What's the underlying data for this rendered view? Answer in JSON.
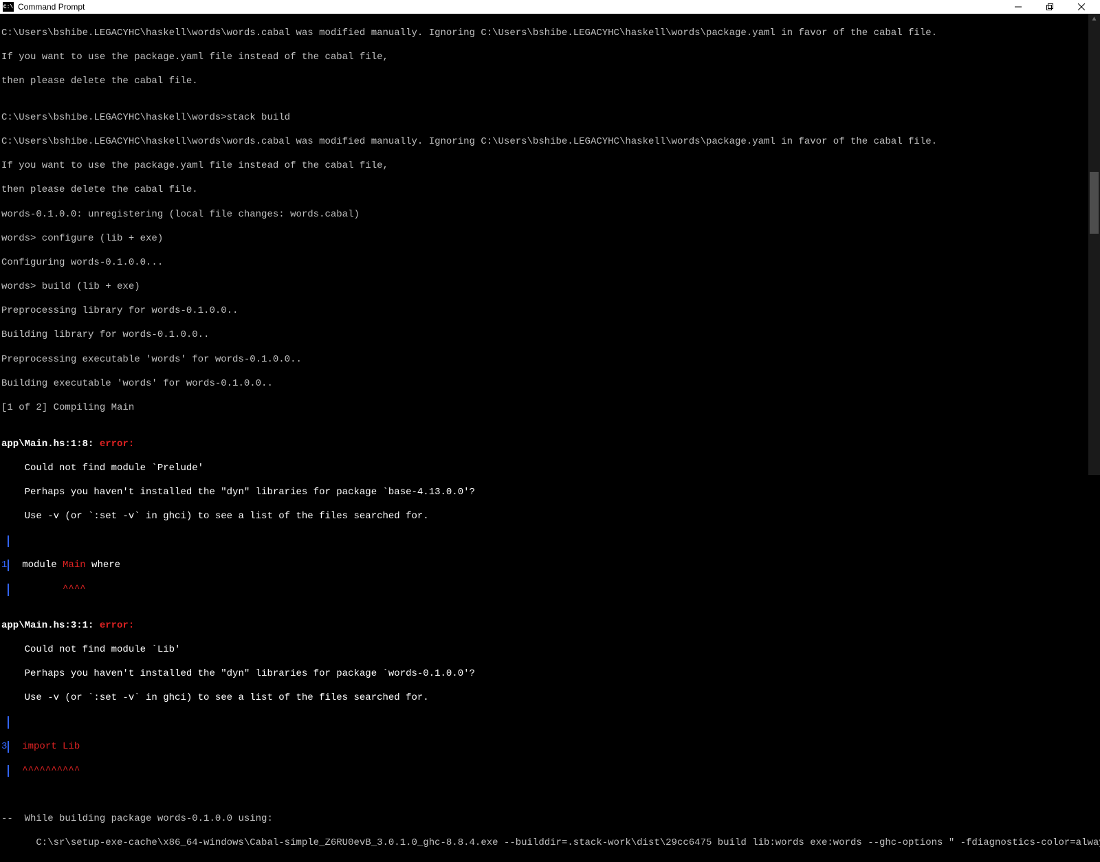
{
  "window": {
    "icon_text": "C:\\",
    "title": "Command Prompt"
  },
  "lines": {
    "l1": "C:\\Users\\bshibe.LEGACYHC\\haskell\\words\\words.cabal was modified manually. Ignoring C:\\Users\\bshibe.LEGACYHC\\haskell\\words\\package.yaml in favor of the cabal file.",
    "l2": "If you want to use the package.yaml file instead of the cabal file,",
    "l3": "then please delete the cabal file.",
    "l4": "",
    "l5": "C:\\Users\\bshibe.LEGACYHC\\haskell\\words>stack build",
    "l6": "C:\\Users\\bshibe.LEGACYHC\\haskell\\words\\words.cabal was modified manually. Ignoring C:\\Users\\bshibe.LEGACYHC\\haskell\\words\\package.yaml in favor of the cabal file.",
    "l7": "If you want to use the package.yaml file instead of the cabal file,",
    "l8": "then please delete the cabal file.",
    "l9": "words-0.1.0.0: unregistering (local file changes: words.cabal)",
    "l10": "words> configure (lib + exe)",
    "l11": "Configuring words-0.1.0.0...",
    "l12": "words> build (lib + exe)",
    "l13": "Preprocessing library for words-0.1.0.0..",
    "l14": "Building library for words-0.1.0.0..",
    "l15": "Preprocessing executable 'words' for words-0.1.0.0..",
    "l16": "Building executable 'words' for words-0.1.0.0..",
    "l17": "[1 of 2] Compiling Main",
    "l18": "",
    "err1_loc": "app\\Main.hs:1:8: ",
    "err1_tag": "error:",
    "err1_msg1": "    Could not find module `Prelude'",
    "err1_msg2": "    Perhaps you haven't installed the \"dyn\" libraries for package `base-4.13.0.0'?",
    "err1_msg3": "    Use -v (or `:set -v` in ghci) to see a list of the files searched for.",
    "err1_gut1": "1",
    "err1_src_a": "  module ",
    "err1_src_b": "Main",
    "err1_src_c": " where",
    "err1_gut2": " ",
    "err1_caret": "         ^^^^",
    "blank": "",
    "err2_loc": "app\\Main.hs:3:1: ",
    "err2_tag": "error:",
    "err2_msg1": "    Could not find module `Lib'",
    "err2_msg2": "    Perhaps you haven't installed the \"dyn\" libraries for package `words-0.1.0.0'?",
    "err2_msg3": "    Use -v (or `:set -v` in ghci) to see a list of the files searched for.",
    "err2_gut1": "3",
    "err2_src": "  import Lib",
    "err2_gut2": " ",
    "err2_caret": "  ^^^^^^^^^^",
    "foot1": "--  While building package words-0.1.0.0 using:",
    "foot2": "      C:\\sr\\setup-exe-cache\\x86_64-windows\\Cabal-simple_Z6RU0evB_3.0.1.0_ghc-8.8.4.exe --builddir=.stack-work\\dist\\29cc6475 build lib:words exe:words --ghc-options \" -fdiagnostics-color=always\""
  }
}
